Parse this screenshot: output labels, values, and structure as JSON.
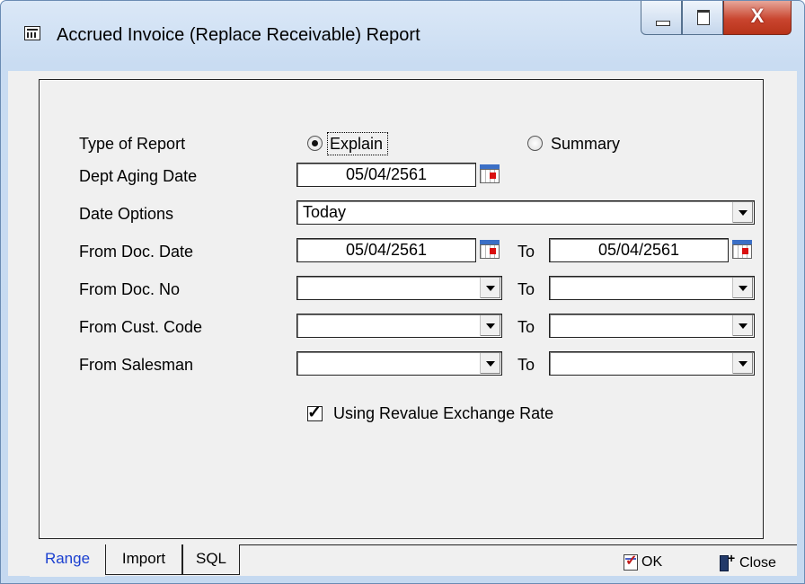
{
  "window": {
    "title": "Accrued Invoice (Replace Receivable) Report",
    "close_glyph": "X"
  },
  "form": {
    "type_of_report": {
      "label": "Type of Report",
      "options": [
        "Explain",
        "Summary"
      ],
      "selected": "Explain"
    },
    "dept_aging_date": {
      "label": "Dept Aging Date",
      "value": "05/04/2561"
    },
    "date_options": {
      "label": "Date Options",
      "value": "Today"
    },
    "from_doc_date": {
      "label": "From Doc. Date",
      "from": "05/04/2561",
      "to_label": "To",
      "to": "05/04/2561"
    },
    "from_doc_no": {
      "label": "From Doc. No",
      "from": "",
      "to_label": "To",
      "to": ""
    },
    "from_cust_code": {
      "label": "From Cust. Code",
      "from": "",
      "to_label": "To",
      "to": ""
    },
    "from_salesman": {
      "label": "From Salesman",
      "from": "",
      "to_label": "To",
      "to": ""
    },
    "revalue": {
      "label": "Using Revalue Exchange Rate",
      "checked": true
    }
  },
  "tabs": [
    "Range",
    "Import",
    "SQL"
  ],
  "active_tab": "Range",
  "actions": {
    "ok": "OK",
    "close": "Close"
  },
  "colors": {
    "active_tab_text": "#1a3fd0",
    "close_button": "#c9452f"
  }
}
